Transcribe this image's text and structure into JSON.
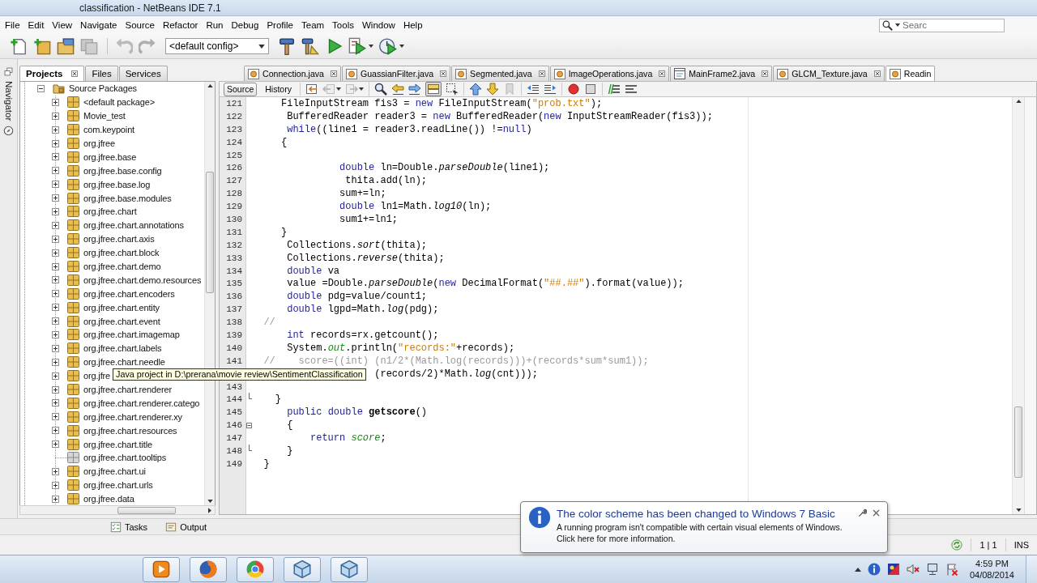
{
  "window": {
    "title": "classification - NetBeans IDE 7.1"
  },
  "menu": [
    "File",
    "Edit",
    "View",
    "Navigate",
    "Source",
    "Refactor",
    "Run",
    "Debug",
    "Profile",
    "Team",
    "Tools",
    "Window",
    "Help"
  ],
  "search": {
    "placeholder": "Searc"
  },
  "toolbar": {
    "groups": [
      [
        {
          "kind": "new-file",
          "disabled": false
        },
        {
          "kind": "new-project",
          "disabled": false
        },
        {
          "kind": "open-project",
          "disabled": false
        },
        {
          "kind": "save-all",
          "disabled": true
        }
      ],
      [
        {
          "kind": "undo",
          "disabled": true
        },
        {
          "kind": "redo",
          "disabled": true
        }
      ],
      [
        {
          "kind": "config",
          "value": "<default config>",
          "disabled": false
        }
      ],
      [
        {
          "kind": "build",
          "disabled": false
        },
        {
          "kind": "clean-build",
          "disabled": false
        },
        {
          "kind": "run",
          "disabled": false
        },
        {
          "kind": "debug",
          "disabled": false
        },
        {
          "kind": "profile",
          "disabled": false
        }
      ]
    ]
  },
  "navigator": {
    "label": "Navigator"
  },
  "project_panel": {
    "tabs": [
      {
        "label": "Projects",
        "selected": true
      },
      {
        "label": "Files",
        "selected": false
      },
      {
        "label": "Services",
        "selected": false
      }
    ],
    "tree": [
      {
        "label": "Source Packages",
        "kind": "source-folder",
        "expanded": true,
        "children": [
          {
            "label": "<default package>",
            "kind": "package",
            "expanded": false
          },
          {
            "label": "Movie_test",
            "kind": "package",
            "expanded": false
          },
          {
            "label": "com.keypoint",
            "kind": "package",
            "expanded": false
          },
          {
            "label": "org.jfree",
            "kind": "package",
            "expanded": false
          },
          {
            "label": "org.jfree.base",
            "kind": "package",
            "expanded": false
          },
          {
            "label": "org.jfree.base.config",
            "kind": "package",
            "expanded": false
          },
          {
            "label": "org.jfree.base.log",
            "kind": "package",
            "expanded": false
          },
          {
            "label": "org.jfree.base.modules",
            "kind": "package",
            "expanded": false
          },
          {
            "label": "org.jfree.chart",
            "kind": "package",
            "expanded": false
          },
          {
            "label": "org.jfree.chart.annotations",
            "kind": "package",
            "expanded": false
          },
          {
            "label": "org.jfree.chart.axis",
            "kind": "package",
            "expanded": false
          },
          {
            "label": "org.jfree.chart.block",
            "kind": "package",
            "expanded": false
          },
          {
            "label": "org.jfree.chart.demo",
            "kind": "package",
            "expanded": false
          },
          {
            "label": "org.jfree.chart.demo.resources",
            "kind": "package",
            "expanded": false
          },
          {
            "label": "org.jfree.chart.encoders",
            "kind": "package",
            "expanded": false
          },
          {
            "label": "org.jfree.chart.entity",
            "kind": "package",
            "expanded": false
          },
          {
            "label": "org.jfree.chart.event",
            "kind": "package",
            "expanded": false
          },
          {
            "label": "org.jfree.chart.imagemap",
            "kind": "package",
            "expanded": false
          },
          {
            "label": "org.jfree.chart.labels",
            "kind": "package",
            "expanded": false
          },
          {
            "label": "org.jfree.chart.needle",
            "kind": "package",
            "expanded": false
          },
          {
            "label": "org.jfre",
            "kind": "package",
            "expanded": false
          },
          {
            "label": "org.jfree.chart.renderer",
            "kind": "package",
            "expanded": false
          },
          {
            "label": "org.jfree.chart.renderer.catego",
            "kind": "package",
            "expanded": false
          },
          {
            "label": "org.jfree.chart.renderer.xy",
            "kind": "package",
            "expanded": false
          },
          {
            "label": "org.jfree.chart.resources",
            "kind": "package",
            "expanded": false
          },
          {
            "label": "org.jfree.chart.title",
            "kind": "package",
            "expanded": false
          },
          {
            "label": "org.jfree.chart.tooltips",
            "kind": "empty-package"
          },
          {
            "label": "org.jfree.chart.ui",
            "kind": "package",
            "expanded": false
          },
          {
            "label": "org.jfree.chart.urls",
            "kind": "package",
            "expanded": false
          },
          {
            "label": "org.jfree.data",
            "kind": "package",
            "expanded": false
          }
        ]
      }
    ]
  },
  "tooltip": {
    "text": "Java project in D:\\prerana\\movie review\\SentimentClassification"
  },
  "editor": {
    "tabs": [
      {
        "label": "Connection.java",
        "kind": "class",
        "selected": false
      },
      {
        "label": "GuassianFilter.java",
        "kind": "class",
        "selected": false
      },
      {
        "label": "Segmented.java",
        "kind": "class",
        "selected": false
      },
      {
        "label": "ImageOperations.java",
        "kind": "class",
        "selected": false
      },
      {
        "label": "MainFrame2.java",
        "kind": "form",
        "selected": false
      },
      {
        "label": "GLCM_Texture.java",
        "kind": "class",
        "selected": false
      },
      {
        "label": "Readin",
        "kind": "class",
        "selected": true
      }
    ],
    "views": [
      {
        "label": "Source",
        "selected": true
      },
      {
        "label": "History",
        "selected": false
      }
    ],
    "toolbar": {
      "groups": [
        [
          {
            "kind": "last-edit",
            "disabled": false,
            "pressed": false
          },
          {
            "kind": "back",
            "disabled": true,
            "pressed": false
          },
          {
            "kind": "forward",
            "disabled": true,
            "pressed": false
          }
        ],
        [
          {
            "kind": "find",
            "disabled": false,
            "pressed": false
          },
          {
            "kind": "find-previous",
            "disabled": false,
            "pressed": false
          },
          {
            "kind": "find-next",
            "disabled": false,
            "pressed": false
          },
          {
            "kind": "highlight",
            "disabled": false,
            "pressed": true
          },
          {
            "kind": "rect-select",
            "disabled": false,
            "pressed": false
          }
        ],
        [
          {
            "kind": "previous-bookmark",
            "disabled": false,
            "pressed": false
          },
          {
            "kind": "next-bookmark",
            "disabled": false,
            "pressed": false
          },
          {
            "kind": "toggle-bookmark",
            "disabled": true,
            "pressed": false
          }
        ],
        [
          {
            "kind": "shift-left",
            "disabled": false,
            "pressed": false
          },
          {
            "kind": "shift-right",
            "disabled": false,
            "pressed": false
          }
        ],
        [
          {
            "kind": "record",
            "disabled": false,
            "pressed": false
          },
          {
            "kind": "stop",
            "disabled": false,
            "pressed": false
          }
        ],
        [
          {
            "kind": "comment",
            "disabled": false,
            "pressed": false
          },
          {
            "kind": "uncomment",
            "disabled": false,
            "pressed": false
          }
        ]
      ]
    },
    "lines": [
      {
        "number": "121",
        "segments": [
          {
            "kind": "plain",
            "text": "     FileInputStream fis3 = "
          },
          {
            "kind": "keyword",
            "text": "new"
          },
          {
            "kind": "plain",
            "text": " FileInputStream("
          },
          {
            "kind": "string",
            "text": "\"prob.txt\""
          },
          {
            "kind": "plain",
            "text": ");"
          }
        ]
      },
      {
        "number": "122",
        "segments": [
          {
            "kind": "plain",
            "text": "      BufferedReader reader3 = "
          },
          {
            "kind": "keyword",
            "text": "new"
          },
          {
            "kind": "plain",
            "text": " BufferedReader("
          },
          {
            "kind": "keyword",
            "text": "new"
          },
          {
            "kind": "plain",
            "text": " InputStreamReader(fis3));"
          }
        ]
      },
      {
        "number": "123",
        "segments": [
          {
            "kind": "keyword",
            "text": "      while"
          },
          {
            "kind": "plain",
            "text": "((line1 = reader3.readLine()) !="
          },
          {
            "kind": "keyword",
            "text": "null"
          },
          {
            "kind": "plain",
            "text": ")"
          }
        ]
      },
      {
        "number": "124",
        "segments": [
          {
            "kind": "plain",
            "text": "     {"
          }
        ]
      },
      {
        "number": "125"
      },
      {
        "number": "126",
        "segments": [
          {
            "kind": "keyword",
            "text": "               double"
          },
          {
            "kind": "plain",
            "text": " ln=Double."
          },
          {
            "kind": "static",
            "text": "parseDouble"
          },
          {
            "kind": "plain",
            "text": "(line1);"
          }
        ]
      },
      {
        "number": "127",
        "segments": [
          {
            "kind": "plain",
            "text": "                thita.add(ln);"
          }
        ]
      },
      {
        "number": "128",
        "segments": [
          {
            "kind": "plain",
            "text": "               sum+=ln;"
          }
        ]
      },
      {
        "number": "129",
        "segments": [
          {
            "kind": "keyword",
            "text": "               double"
          },
          {
            "kind": "plain",
            "text": " ln1=Math."
          },
          {
            "kind": "static",
            "text": "log10"
          },
          {
            "kind": "plain",
            "text": "(ln);"
          }
        ]
      },
      {
        "number": "130",
        "segments": [
          {
            "kind": "plain",
            "text": "               sum1+=ln1;"
          }
        ]
      },
      {
        "number": "131",
        "segments": [
          {
            "kind": "plain",
            "text": "     }"
          }
        ]
      },
      {
        "number": "132",
        "segments": [
          {
            "kind": "plain",
            "text": "      Collections."
          },
          {
            "kind": "static",
            "text": "sort"
          },
          {
            "kind": "plain",
            "text": "(thita);"
          }
        ]
      },
      {
        "number": "133",
        "segments": [
          {
            "kind": "plain",
            "text": "      Collections."
          },
          {
            "kind": "static",
            "text": "reverse"
          },
          {
            "kind": "plain",
            "text": "(thita);"
          }
        ]
      },
      {
        "number": "134",
        "segments": [
          {
            "kind": "keyword",
            "text": "      double"
          },
          {
            "kind": "plain",
            "text": " va"
          }
        ]
      },
      {
        "number": "135",
        "segments": [
          {
            "kind": "plain",
            "text": "      value =Double."
          },
          {
            "kind": "static",
            "text": "parseDouble"
          },
          {
            "kind": "plain",
            "text": "("
          },
          {
            "kind": "keyword",
            "text": "new"
          },
          {
            "kind": "plain",
            "text": " DecimalFormat("
          },
          {
            "kind": "string",
            "text": "\"##.##\""
          },
          {
            "kind": "plain",
            "text": ").format(value));"
          }
        ]
      },
      {
        "number": "136",
        "segments": [
          {
            "kind": "keyword",
            "text": "      double"
          },
          {
            "kind": "plain",
            "text": " pdg=value/count1;"
          }
        ]
      },
      {
        "number": "137",
        "segments": [
          {
            "kind": "keyword",
            "text": "      double"
          },
          {
            "kind": "plain",
            "text": " lgpd=Math."
          },
          {
            "kind": "static",
            "text": "log"
          },
          {
            "kind": "plain",
            "text": "(pdg);"
          }
        ]
      },
      {
        "number": "138",
        "segments": [
          {
            "kind": "comment",
            "text": "  //"
          }
        ]
      },
      {
        "number": "139",
        "segments": [
          {
            "kind": "keyword",
            "text": "      int"
          },
          {
            "kind": "plain",
            "text": " records=rx.getcount();"
          }
        ]
      },
      {
        "number": "140",
        "segments": [
          {
            "kind": "plain",
            "text": "      System."
          },
          {
            "kind": "field",
            "text": "out"
          },
          {
            "kind": "plain",
            "text": ".println("
          },
          {
            "kind": "string",
            "text": "\"records:\""
          },
          {
            "kind": "plain",
            "text": "+records);"
          }
        ]
      },
      {
        "number": "141",
        "segments": [
          {
            "kind": "comment",
            "text": "  //    score=((int) (n1/2*(Math.log(records)))+(records*sum*sum1));"
          }
        ]
      },
      {
        "segments": [
          {
            "kind": "plain",
            "text": "                     (records/2)*Math."
          },
          {
            "kind": "static",
            "text": "log"
          },
          {
            "kind": "plain",
            "text": "(cnt)));"
          }
        ]
      },
      {
        "number": "143"
      },
      {
        "number": "144",
        "fold": {
          "kind": "end"
        },
        "segments": [
          {
            "kind": "plain",
            "text": "    }"
          }
        ]
      },
      {
        "number": "145",
        "segments": [
          {
            "kind": "keyword",
            "text": "      public double "
          },
          {
            "kind": "declaration",
            "text": "getscore"
          },
          {
            "kind": "plain",
            "text": "()"
          }
        ]
      },
      {
        "number": "146",
        "fold": {
          "kind": "start"
        },
        "segments": [
          {
            "kind": "plain",
            "text": "      {"
          }
        ]
      },
      {
        "number": "147",
        "segments": [
          {
            "kind": "keyword",
            "text": "          return "
          },
          {
            "kind": "field",
            "text": "score"
          },
          {
            "kind": "plain",
            "text": ";"
          }
        ]
      },
      {
        "number": "148",
        "fold": {
          "kind": "end"
        },
        "segments": [
          {
            "kind": "plain",
            "text": "      }"
          }
        ]
      },
      {
        "number": "149",
        "segments": [
          {
            "kind": "plain",
            "text": "  }"
          }
        ]
      }
    ]
  },
  "bottom_tabs": [
    {
      "label": "Tasks",
      "kind": "tasks"
    },
    {
      "label": "Output",
      "kind": "output"
    }
  ],
  "status_bar": {
    "position": "1 | 1",
    "mode": "INS"
  },
  "notification": {
    "title": "The color scheme has been changed to Windows 7 Basic",
    "lines": [
      "A running program isn't compatible with certain visual elements of Windows.",
      "Click here for more information."
    ]
  },
  "taskbar": {
    "time": "4:59 PM",
    "date": "04/08/2014"
  }
}
